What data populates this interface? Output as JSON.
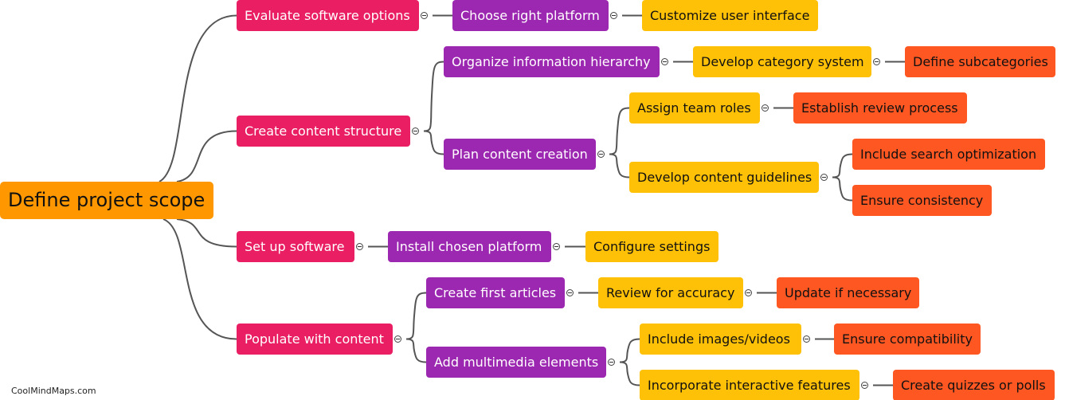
{
  "title": "Define project scope",
  "colors": {
    "root": "#ff9800",
    "level1": "#e91e63",
    "level2": "#9c27b0",
    "level3": "#ffc107",
    "level4": "#ff5722",
    "link": "#555555"
  },
  "nodes": [
    {
      "id": "root",
      "label": "Define project scope",
      "level": 0,
      "parent": null
    },
    {
      "id": "n1",
      "label": "Evaluate software options",
      "level": 1,
      "parent": "root"
    },
    {
      "id": "n2",
      "label": "Create content structure",
      "level": 1,
      "parent": "root"
    },
    {
      "id": "n3",
      "label": "Set up software",
      "level": 1,
      "parent": "root"
    },
    {
      "id": "n4",
      "label": "Populate with content",
      "level": 1,
      "parent": "root"
    },
    {
      "id": "n1a",
      "label": "Choose right platform",
      "level": 2,
      "parent": "n1"
    },
    {
      "id": "n1a1",
      "label": "Customize user interface",
      "level": 3,
      "parent": "n1a"
    },
    {
      "id": "n2a",
      "label": "Organize information hierarchy",
      "level": 2,
      "parent": "n2"
    },
    {
      "id": "n2a1",
      "label": "Develop category system",
      "level": 3,
      "parent": "n2a"
    },
    {
      "id": "n2a1a",
      "label": "Define subcategories",
      "level": 4,
      "parent": "n2a1"
    },
    {
      "id": "n2b",
      "label": "Plan content creation",
      "level": 2,
      "parent": "n2"
    },
    {
      "id": "n2b1",
      "label": "Assign team roles",
      "level": 3,
      "parent": "n2b"
    },
    {
      "id": "n2b1a",
      "label": "Establish review process",
      "level": 4,
      "parent": "n2b1"
    },
    {
      "id": "n2b2",
      "label": "Develop content guidelines",
      "level": 3,
      "parent": "n2b"
    },
    {
      "id": "n2b2a",
      "label": "Include search optimization",
      "level": 4,
      "parent": "n2b2"
    },
    {
      "id": "n2b2b",
      "label": "Ensure consistency",
      "level": 4,
      "parent": "n2b2"
    },
    {
      "id": "n3a",
      "label": "Install chosen platform",
      "level": 2,
      "parent": "n3"
    },
    {
      "id": "n3a1",
      "label": "Configure settings",
      "level": 3,
      "parent": "n3a"
    },
    {
      "id": "n4a",
      "label": "Create first articles",
      "level": 2,
      "parent": "n4"
    },
    {
      "id": "n4a1",
      "label": "Review for accuracy",
      "level": 3,
      "parent": "n4a"
    },
    {
      "id": "n4a1a",
      "label": "Update if necessary",
      "level": 4,
      "parent": "n4a1"
    },
    {
      "id": "n4b",
      "label": "Add multimedia elements",
      "level": 2,
      "parent": "n4"
    },
    {
      "id": "n4b1",
      "label": "Include images/videos",
      "level": 3,
      "parent": "n4b"
    },
    {
      "id": "n4b1a",
      "label": "Ensure compatibility",
      "level": 4,
      "parent": "n4b1"
    },
    {
      "id": "n4b2",
      "label": "Incorporate interactive features",
      "level": 3,
      "parent": "n4b"
    },
    {
      "id": "n4b2a",
      "label": "Create quizzes or polls",
      "level": 4,
      "parent": "n4b2"
    }
  ],
  "watermark": "CoolMindMaps.com",
  "toggle_icon": "collapse-minus-icon"
}
